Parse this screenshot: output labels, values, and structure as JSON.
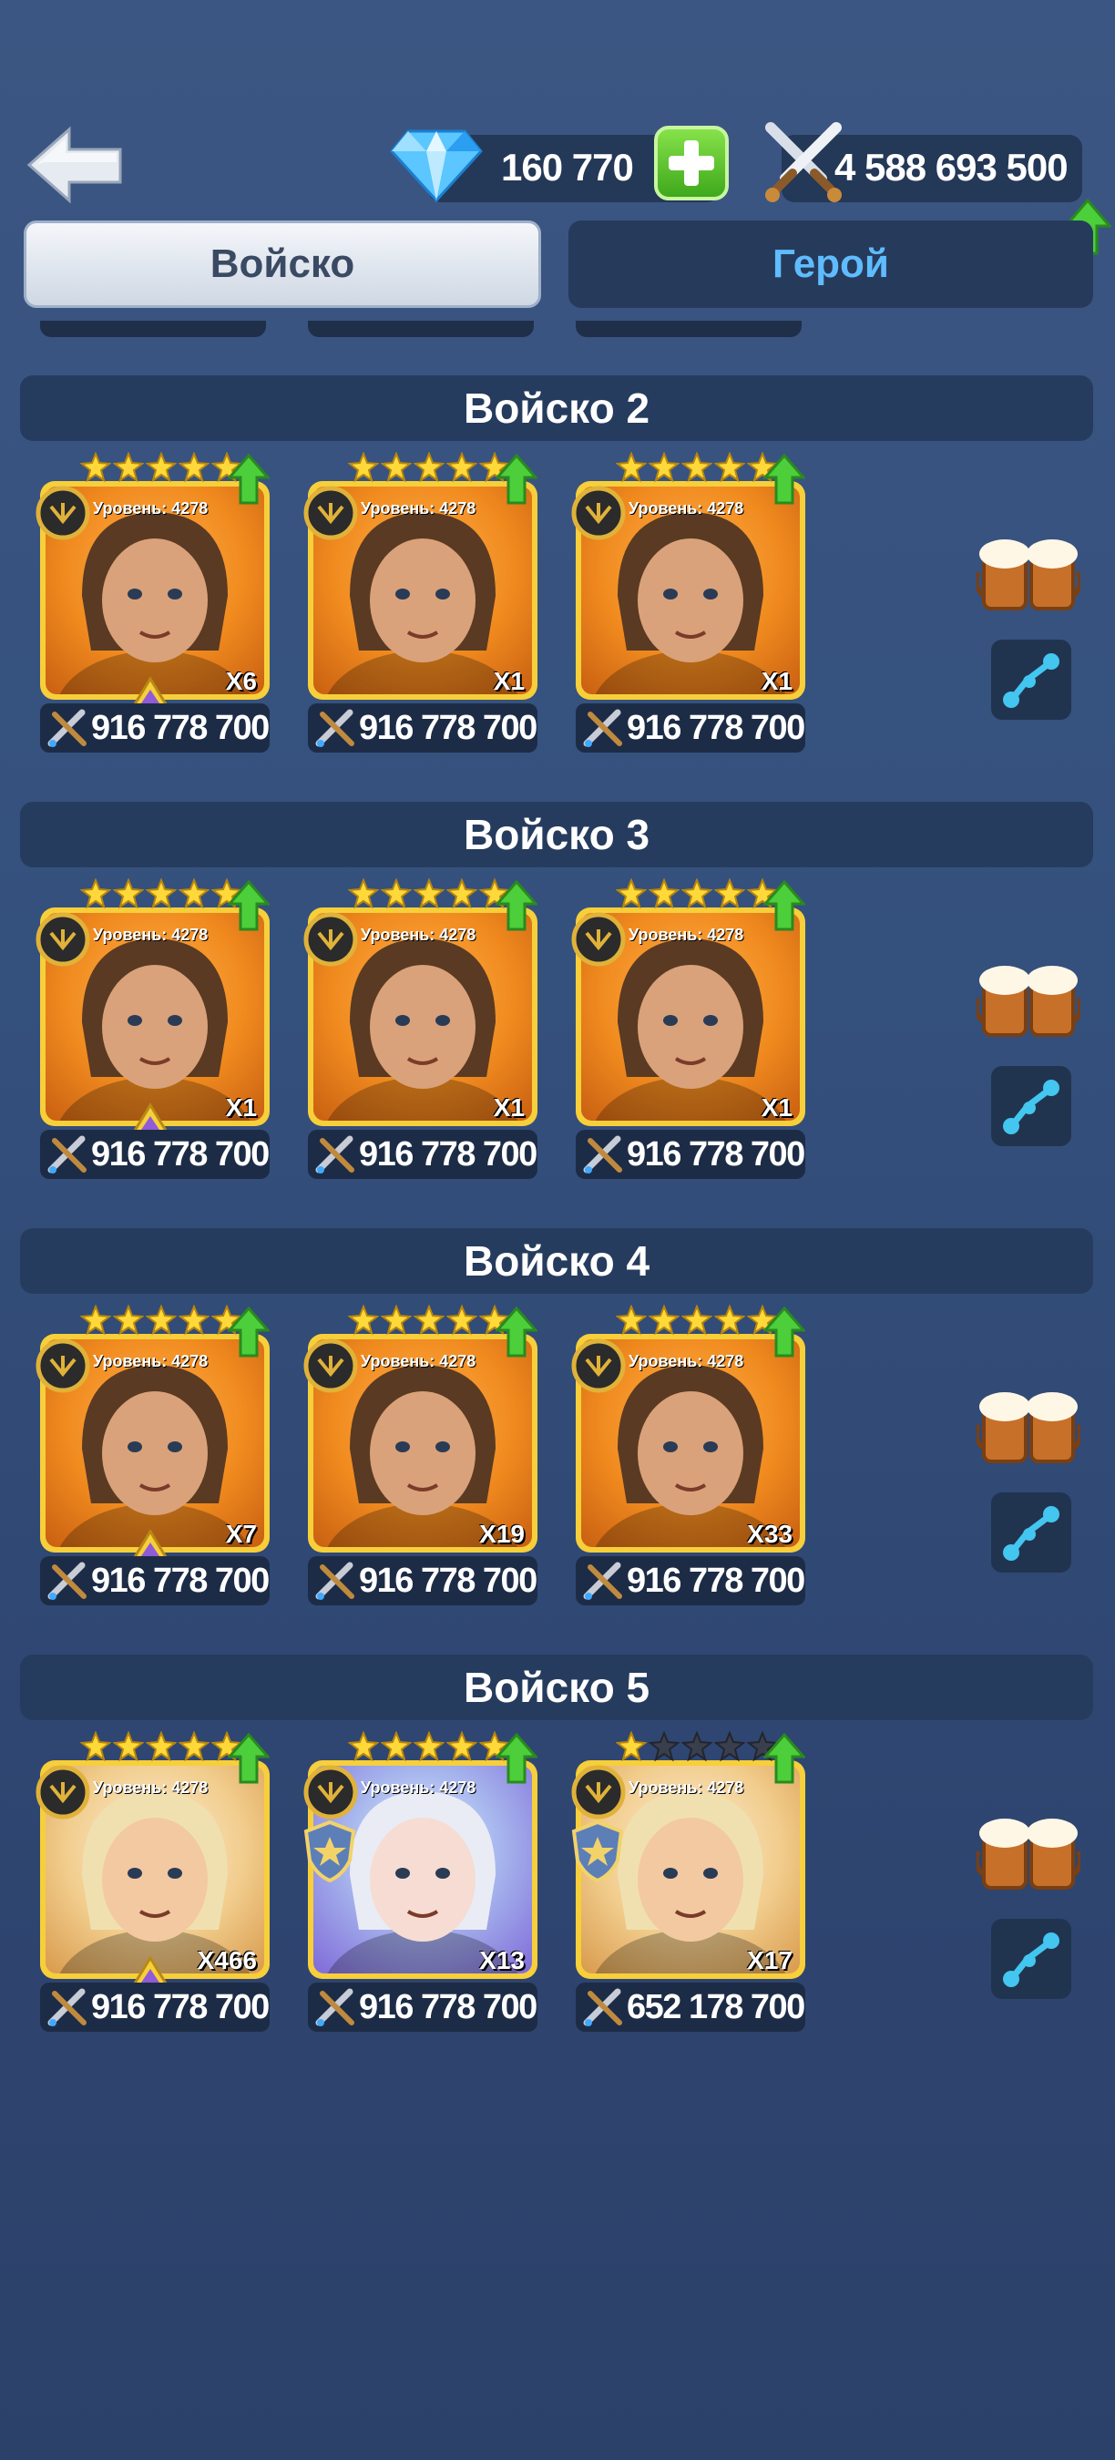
{
  "header": {
    "gems": "160 770",
    "power": "4 588 693 500"
  },
  "tabs": {
    "army": "Войско",
    "hero": "Герой"
  },
  "squads": [
    {
      "title": "Войско 2",
      "cards": [
        {
          "level": "Уровень: 4278",
          "count": "X6",
          "power": "916 778 700",
          "stars": 5,
          "portrait": "pirate-hero",
          "rank_badge": true,
          "shield": false,
          "style": "orange"
        },
        {
          "level": "Уровень: 4278",
          "count": "X1",
          "power": "916 778 700",
          "stars": 5,
          "portrait": "skull-mask-hero",
          "rank_badge": false,
          "shield": false,
          "style": "orange"
        },
        {
          "level": "Уровень: 4278",
          "count": "X1",
          "power": "916 778 700",
          "stars": 5,
          "portrait": "blond-bearded-hero",
          "rank_badge": false,
          "shield": false,
          "style": "orange"
        }
      ]
    },
    {
      "title": "Войско 3",
      "cards": [
        {
          "level": "Уровень: 4278",
          "count": "X1",
          "power": "916 778 700",
          "stars": 5,
          "portrait": "masked-woman-hero",
          "rank_badge": true,
          "shield": false,
          "style": "orange"
        },
        {
          "level": "Уровень: 4278",
          "count": "X1",
          "power": "916 778 700",
          "stars": 5,
          "portrait": "elf-hero",
          "rank_badge": false,
          "shield": false,
          "style": "orange"
        },
        {
          "level": "Уровень: 4278",
          "count": "X1",
          "power": "916 778 700",
          "stars": 5,
          "portrait": "grey-wizard-hero",
          "rank_badge": false,
          "shield": false,
          "style": "orange"
        }
      ]
    },
    {
      "title": "Войско 4",
      "cards": [
        {
          "level": "Уровень: 4278",
          "count": "X7",
          "power": "916 778 700",
          "stars": 5,
          "portrait": "panda-hero",
          "rank_badge": true,
          "shield": false,
          "style": "orange"
        },
        {
          "level": "Уровень: 4278",
          "count": "X19",
          "power": "916 778 700",
          "stars": 5,
          "portrait": "red-haired-warrior-hero",
          "rank_badge": false,
          "shield": false,
          "style": "orange"
        },
        {
          "level": "Уровень: 4278",
          "count": "X33",
          "power": "916 778 700",
          "stars": 5,
          "portrait": "blue-demon-hero",
          "rank_badge": false,
          "shield": false,
          "style": "orange"
        }
      ]
    },
    {
      "title": "Войско 5",
      "cards": [
        {
          "level": "Уровень: 4278",
          "count": "X466",
          "power": "916 778 700",
          "stars": 5,
          "portrait": "dwarf-hero",
          "rank_badge": true,
          "shield": false,
          "style": "pale"
        },
        {
          "level": "Уровень: 4278",
          "count": "X13",
          "power": "916 778 700",
          "stars": 5,
          "portrait": "ice-queen-hero",
          "rank_badge": false,
          "shield": true,
          "style": "blue"
        },
        {
          "level": "Уровень: 4278",
          "count": "X17",
          "power": "652 178 700",
          "stars": 1,
          "portrait": "valkyrie-hero",
          "rank_badge": false,
          "shield": true,
          "style": "pale"
        }
      ]
    }
  ],
  "icons": {
    "back": "back-arrow-icon",
    "gem": "diamond-icon",
    "plus": "plus-icon",
    "power": "crossed-swords-icon",
    "upgrade": "green-up-arrow-icon",
    "beer": "beer-mugs-icon",
    "link": "link-nodes-icon",
    "emblem": "faction-emblem-icon",
    "rank": "rank-triangle-icon",
    "card_power": "crossed-weapons-icon"
  },
  "colors": {
    "background": "#34507c",
    "accent_hero_tab": "#5fbcff",
    "card_gold": "#f7cf3a",
    "upgrade_green": "#4ccf3a"
  }
}
